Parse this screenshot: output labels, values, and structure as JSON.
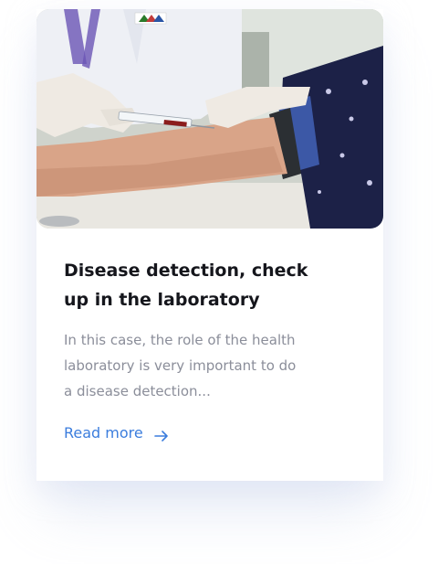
{
  "card": {
    "image_alt": "Blood sample being drawn from a patient's arm in a laboratory",
    "title": "Disease detection, check up in the laboratory",
    "excerpt": "In this case, the role of the health laboratory is very important to do a disease detection...",
    "link_label": "Read more",
    "link_icon": "arrow-right-icon"
  },
  "colors": {
    "title": "#15161c",
    "excerpt": "#8b8e9a",
    "link": "#3b7ddd",
    "card_bg": "#ffffff"
  }
}
